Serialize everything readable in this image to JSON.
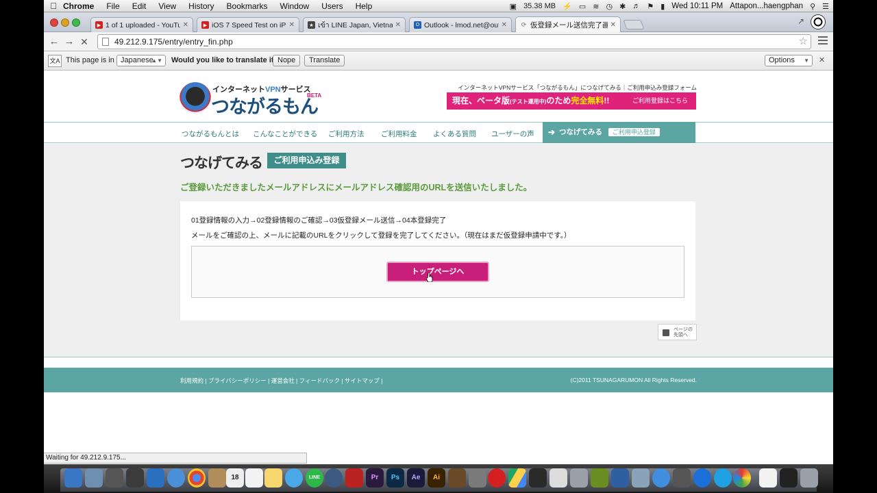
{
  "menubar": {
    "app": "Chrome",
    "items": [
      "File",
      "Edit",
      "View",
      "History",
      "Bookmarks",
      "Window",
      "Users",
      "Help"
    ],
    "memory": "35.38 MB",
    "clock": "Wed 10:11 PM",
    "user": "Attapon...haengphan"
  },
  "tabs": [
    {
      "title": "1 of 1 uploaded - YouTub",
      "favicon_color": "#d42020"
    },
    {
      "title": "iOS 7 Speed Test on iPhon",
      "favicon_color": "#d42020"
    },
    {
      "title": "เข้า LINE Japan, Vietnam, Ko",
      "favicon_color": "#444444"
    },
    {
      "title": "Outlook - lmod.net@outlo",
      "favicon_color": "#1f5fb8"
    },
    {
      "title": "仮登録メール送信完了画面 |",
      "favicon_color": "#cccccc"
    }
  ],
  "address": {
    "url": "49.212.9.175/entry/entry_fin.php"
  },
  "translate": {
    "prefix": "This page is in",
    "language": "Japanese",
    "question": "Would you like to translate it?",
    "nope": "Nope",
    "translate": "Translate",
    "options": "Options"
  },
  "site": {
    "logo_sub_prefix": "インターネット",
    "logo_sub_vpn": "VPN",
    "logo_sub_suffix": "サービス",
    "logo_main": "つながるもん",
    "logo_beta": "BETA",
    "tagline": "インターネットVPNサービス「つながるもん」につなげてみる｜ご利用申込み登録フォーム",
    "banner_prefix": "現在、ベータ版",
    "banner_small": "(テスト運用中)",
    "banner_mid": "のため",
    "banner_free": "完全無料",
    "banner_end": "!!",
    "banner_register": "ご利用登録はこちら",
    "nav": [
      "つながるもんとは",
      "こんなことができる",
      "ご利用方法",
      "ご利用料金",
      "よくある質問",
      "ユーザーの声"
    ],
    "nav_cta": "つなげてみる",
    "nav_cta_pill": "ご利用申込登録",
    "title": "つなげてみる",
    "title_badge": "ご利用申込み登録",
    "notice": "ご登録いただきましたメールアドレスにメールアドレス確認用のURLを送信いたしました。",
    "steps": "01登録情報の入力→02登録情報のご確認→03仮登録メール送信→04本登録完了",
    "instruction": "メールをご確認の上、メールに記載のURLをクリックして登録を完了してください。（現在はまだ仮登録申請中です。）",
    "top_button": "トップページへ",
    "page_top_line1": "ページの",
    "page_top_line2": "先頭へ",
    "footer_links": "利用規約 | プライバシーポリシー | 運営会社 | フィードバック | サイトマップ |",
    "copyright": "(C)2011 TSUNAGARUMON All Rights Reserved."
  },
  "status": "Waiting for 49.212.9.175...",
  "dock": {
    "labels": [
      "Pr",
      "Ps",
      "Ae",
      "Ai"
    ]
  },
  "colors": {
    "teal": "#5ba6a3",
    "magenta": "#c81f7a",
    "notice_green": "#5a9a3c"
  }
}
